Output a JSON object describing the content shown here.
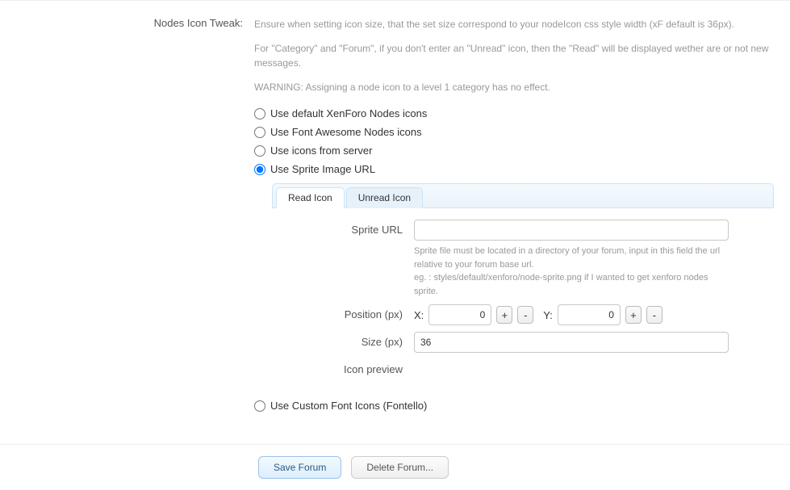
{
  "section": {
    "label": "Nodes Icon Tweak:",
    "hint1": "Ensure when setting icon size, that the set size correspond to your nodeIcon css style width (xF default is 36px).",
    "hint2": "For \"Category\" and \"Forum\", if you don't enter an \"Unread\" icon, then the \"Read\" will be displayed wether are or not new messages.",
    "hint3": "WARNING: Assigning a node icon to a level 1 category has no effect."
  },
  "radios": {
    "default": "Use default XenForo Nodes icons",
    "fontawesome": "Use Font Awesome Nodes icons",
    "server": "Use icons from server",
    "sprite": "Use Sprite Image URL",
    "custom": "Use Custom Font Icons (Fontello)"
  },
  "tabs": {
    "read": "Read Icon",
    "unread": "Unread Icon"
  },
  "sprite": {
    "url_label": "Sprite URL",
    "url_value": "",
    "url_hint": "Sprite file must be located in a directory of your forum, input in this field the url relative to your forum base url.\neg. : styles/default/xenforo/node-sprite.png if I wanted to get xenforo nodes sprite.",
    "position_label": "Position (px)",
    "x_label": "X:",
    "x_value": "0",
    "y_label": "Y:",
    "y_value": "0",
    "plus": "+",
    "minus": "-",
    "size_label": "Size (px)",
    "size_value": "36",
    "preview_label": "Icon preview"
  },
  "footer": {
    "save": "Save Forum",
    "delete": "Delete Forum..."
  }
}
